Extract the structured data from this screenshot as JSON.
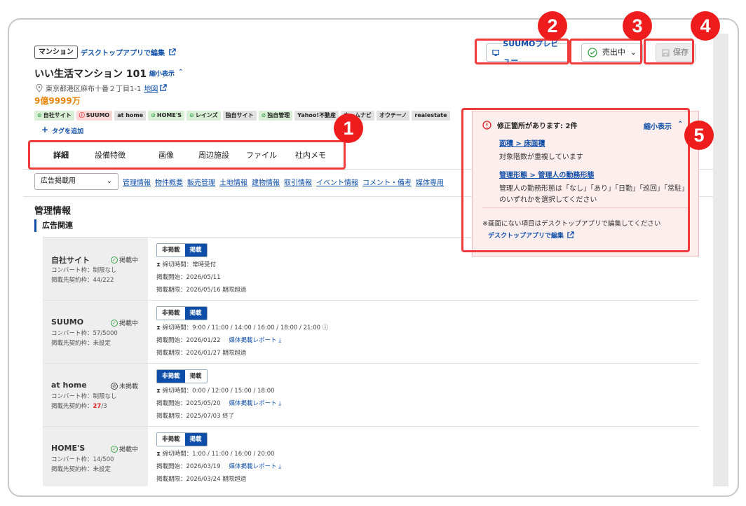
{
  "property": {
    "type_tag": "マンション",
    "edit_desktop": "デスクトップアプリで編集",
    "name": "いい生活マンション 101",
    "collapse": "縮小表示",
    "address": "東京都港区麻布十番２丁目1-1",
    "map": "地図",
    "price": "9億9999万"
  },
  "header": {
    "suumo_preview": "SUUMOプレビュー",
    "status": "売出中",
    "save": "保存"
  },
  "chips": [
    {
      "label": "自社サイト",
      "state": "ok"
    },
    {
      "label": "SUUMO",
      "state": "error"
    },
    {
      "label": "at home",
      "state": "none"
    },
    {
      "label": "HOME'S",
      "state": "ok"
    },
    {
      "label": "レインズ",
      "state": "ok"
    },
    {
      "label": "独自サイト",
      "state": "none"
    },
    {
      "label": "独自管理",
      "state": "ok"
    },
    {
      "label": "Yahoo!不動産",
      "state": "none"
    },
    {
      "label": "ホームナビ",
      "state": "none"
    },
    {
      "label": "オウチーノ",
      "state": "none"
    },
    {
      "label": "realestate",
      "state": "none"
    }
  ],
  "add_tag": "タグを追加",
  "tabs": [
    "詳細",
    "設備特徴",
    "画像",
    "周辺施設",
    "ファイル",
    "社内メモ"
  ],
  "filter": {
    "select": "広告掲載用",
    "links": [
      "管理情報",
      "物件概要",
      "販売管理",
      "土地情報",
      "建物情報",
      "取引情報",
      "イベント情報",
      "コメント・備考",
      "媒体専用"
    ]
  },
  "section": {
    "title": "管理情報",
    "subtitle": "広告関連"
  },
  "rows": [
    {
      "name": "自社サイト",
      "status": "掲載中",
      "status_ok": true,
      "sub1": "コンバート枠：制限なし",
      "sub2_label": "掲載先契約枠：",
      "sub2_value": "44/222",
      "sub2_red": "",
      "off": "非掲載",
      "on": "掲載",
      "active": "on",
      "deadline": "締切時間：常時受付",
      "start": "掲載開始：2026/05/11",
      "report": "",
      "end": "掲載期限：2026/05/16 期限超過"
    },
    {
      "name": "SUUMO",
      "status": "掲載中",
      "status_ok": true,
      "sub1": "コンバート枠：57/5000",
      "sub2_label": "掲載先契約枠：",
      "sub2_value": "未設定",
      "sub2_red": "",
      "off": "非掲載",
      "on": "掲載",
      "active": "on",
      "deadline": "締切時間：9:00 / 11:00 / 14:00 / 16:00 / 18:00 / 21:00",
      "start": "掲載開始：2026/01/22",
      "report": "媒体掲載レポート",
      "end": "掲載期限：2026/01/27 期限超過"
    },
    {
      "name": "at home",
      "status": "未掲載",
      "status_ok": false,
      "sub1": "コンバート枠：制限なし",
      "sub2_label": "掲載先契約枠：",
      "sub2_value": "/3",
      "sub2_red": "27",
      "off": "非掲載",
      "on": "掲載",
      "active": "off",
      "deadline": "締切時間：0:00 / 12:00 / 15:00 / 18:00",
      "start": "掲載開始：2025/05/20",
      "report": "媒体掲載レポート",
      "end": "掲載期限：2025/07/03 終了"
    },
    {
      "name": "HOME'S",
      "status": "掲載中",
      "status_ok": true,
      "sub1": "コンバート枠：14/500",
      "sub2_label": "掲載先契約枠：",
      "sub2_value": "未設定",
      "sub2_red": "",
      "off": "非掲載",
      "on": "掲載",
      "active": "on",
      "deadline": "締切時間：1:00 / 11:00 / 16:00 / 20:00",
      "start": "掲載開始：2026/03/19",
      "report": "媒体掲載レポート",
      "end": "掲載期限：2026/03/24 期限超過"
    }
  ],
  "errors": {
    "title": "修正箇所があります: 2件",
    "collapse": "縮小表示",
    "items": [
      {
        "link": "面積 > 床面積",
        "desc": "対象階数が重複しています"
      },
      {
        "link": "管理形態 > 管理人の勤務形態",
        "desc": "管理人の勤務形態は「なし」「あり」「日勤」「巡回」「常駐」のいずれかを選択してください"
      }
    ],
    "note": "※画面にない項目はデスクトップアプリで編集してください",
    "desktop_link": "デスクトップアプリで編集"
  },
  "badges": [
    "1",
    "2",
    "3",
    "4",
    "5"
  ],
  "colors": {
    "accent": "#0e4ea8",
    "price": "#e8850c",
    "badge": "#ee1c1c",
    "error_bg": "#fdeeee"
  }
}
